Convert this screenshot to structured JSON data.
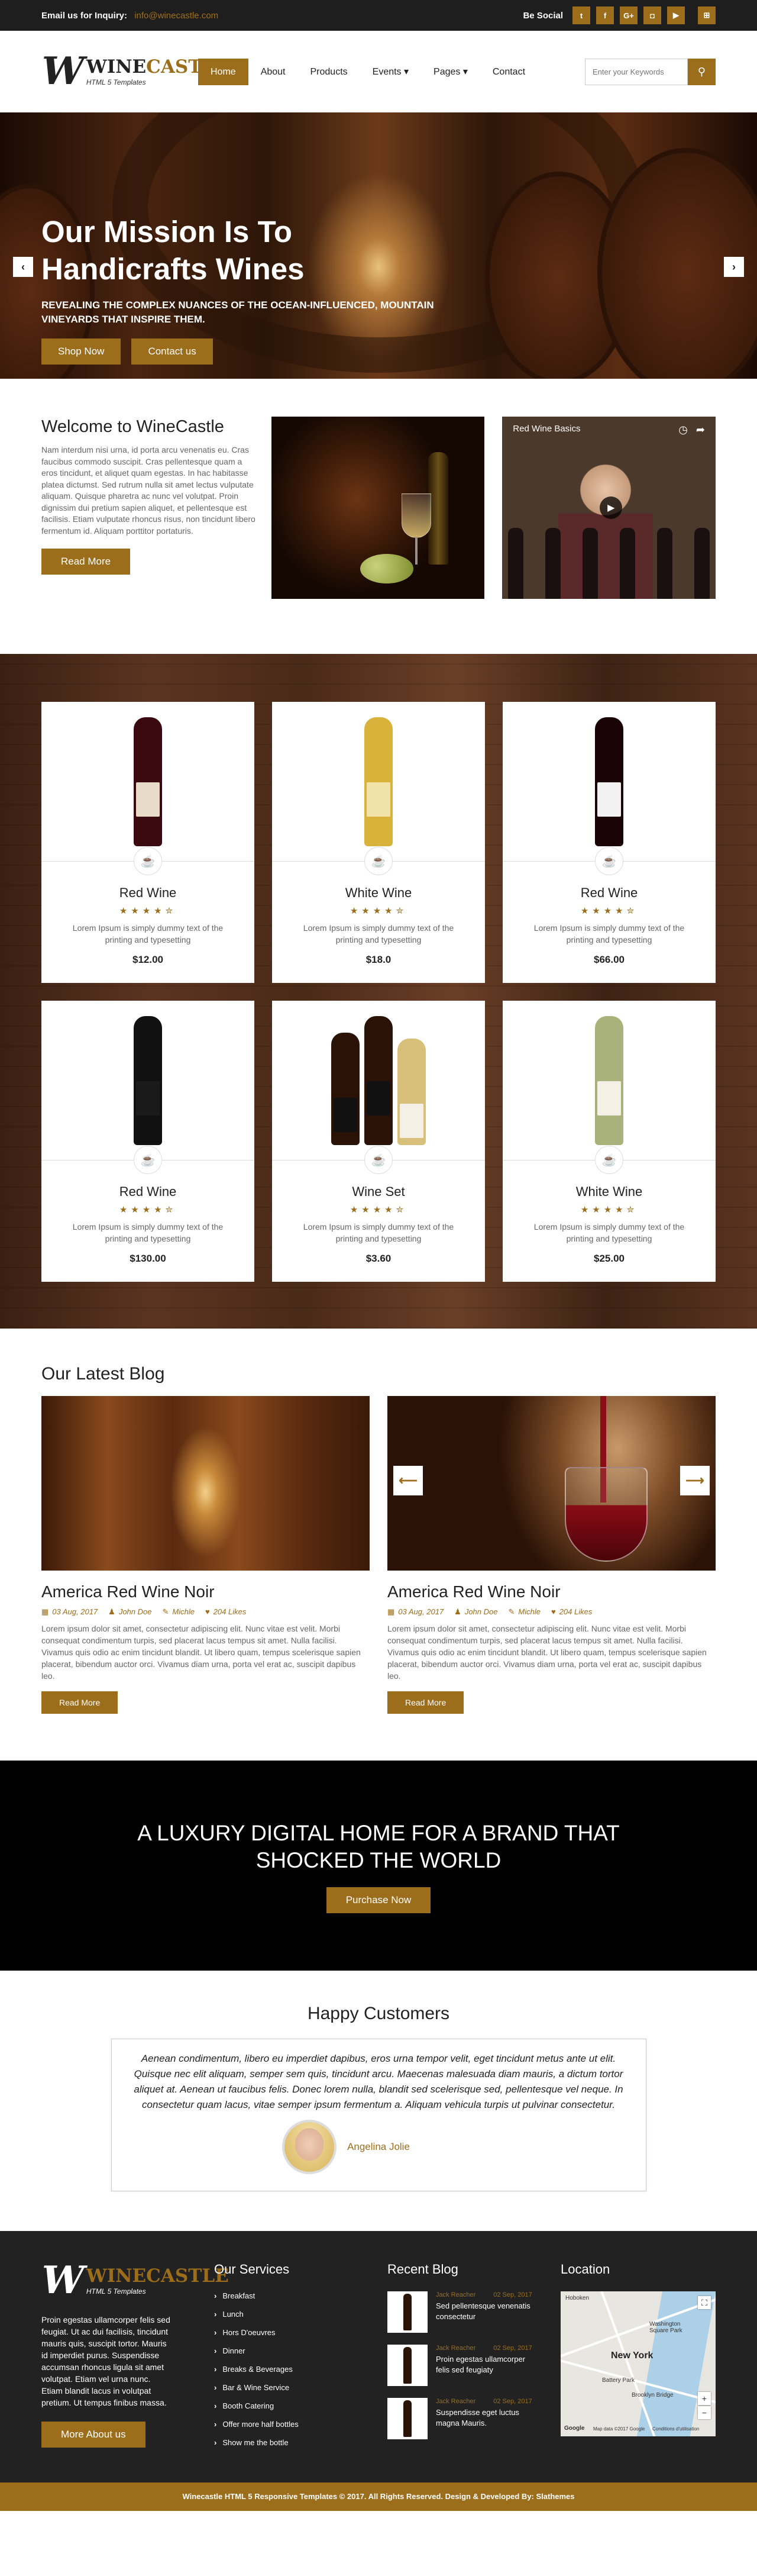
{
  "topbar": {
    "email_label": "Email us for Inquiry:",
    "email": "info@winecastle.com",
    "social_label": "Be Social",
    "social": [
      {
        "icon": "twitter-icon",
        "glyph": "t"
      },
      {
        "icon": "facebook-icon",
        "glyph": "f"
      },
      {
        "icon": "google-plus-icon",
        "glyph": "G+"
      },
      {
        "icon": "instagram-icon",
        "glyph": "◘"
      },
      {
        "icon": "youtube-icon",
        "glyph": "▶"
      },
      {
        "icon": "cart-icon",
        "glyph": "⊞"
      }
    ]
  },
  "logo": {
    "prefix": "WINE",
    "suffix": "CASTLE",
    "sub": "HTML 5 Templates"
  },
  "nav": [
    "Home",
    "About",
    "Products",
    "Events ▾",
    "Pages ▾",
    "Contact"
  ],
  "search": {
    "placeholder": "Enter your Keywords"
  },
  "hero": {
    "title": "Our Mission Is To Handicrafts Wines",
    "subtitle": "REVEALING THE COMPLEX NUANCES OF THE OCEAN-INFLUENCED, MOUNTAIN VINEYARDS THAT INSPIRE THEM.",
    "btn1": "Shop Now",
    "btn2": "Contact us",
    "prev": "‹",
    "next": "›"
  },
  "welcome": {
    "title": "Welcome to WineCastle",
    "text": "Nam interdum nisi urna, id porta arcu venenatis eu. Cras faucibus commodo suscipit. Cras pellentesque quam a eros tincidunt, et aliquet quam egestas. In hac habitasse platea dictumst. Sed rutrum nulla sit amet lectus vulputate aliquam. Quisque pharetra ac nunc vel volutpat. Proin dignissim dui pretium sapien aliquet, et pellentesque est facilisis. Etiam vulputate rhoncus risus, non tincidunt libero fermentum id. Aliquam porttitor portaturis.",
    "btn": "Read More",
    "video_title": "Red Wine Basics"
  },
  "products": [
    {
      "name": "Red Wine",
      "desc": "Lorem Ipsum is simply dummy text of the printing and typesetting",
      "price": "$12.00",
      "stars": "★★★★✮",
      "glass": "#3b0a10",
      "label": "#e8dcc8"
    },
    {
      "name": "White Wine",
      "desc": "Lorem Ipsum is simply dummy text of the printing and typesetting",
      "price": "$18.0",
      "stars": "★★★★✮",
      "glass": "#d8b23a",
      "label": "#f0e2a8"
    },
    {
      "name": "Red Wine",
      "desc": "Lorem Ipsum is simply dummy text of the printing and typesetting",
      "price": "$66.00",
      "stars": "★★★★✮",
      "glass": "#1a0406",
      "label": "#f2f2f2"
    },
    {
      "name": "Red Wine",
      "desc": "Lorem Ipsum is simply dummy text of the printing and typesetting",
      "price": "$130.00",
      "stars": "★★★★✮",
      "glass": "#111111",
      "label": "#1a1a1a"
    },
    {
      "name": "Wine Set",
      "desc": "Lorem Ipsum is simply dummy text of the printing and typesetting",
      "price": "$3.60",
      "stars": "★★★★✮",
      "glass": "#2a1206",
      "label": "#111111"
    },
    {
      "name": "White Wine",
      "desc": "Lorem Ipsum is simply dummy text of the printing and typesetting",
      "price": "$25.00",
      "stars": "★★★★✮",
      "glass": "#a8b27a",
      "label": "#f4f0e6"
    }
  ],
  "blog": {
    "title": "Our Latest Blog",
    "posts": [
      {
        "title": "America Red Wine Noir",
        "date": "03 Aug, 2017",
        "author": "John Doe",
        "cat": "Michle",
        "likes": "204 Likes",
        "excerpt": "Lorem ipsum dolor sit amet, consectetur adipiscing elit. Nunc vitae est velit. Morbi consequat condimentum turpis, sed placerat lacus tempus sit amet. Nulla facilisi. Vivamus quis odio ac enim tincidunt blandit. Ut libero quam, tempus scelerisque sapien placerat, bibendum auctor orci. Vivamus diam urna, porta vel erat ac, suscipit dapibus leo.",
        "btn": "Read More"
      },
      {
        "title": "America Red Wine Noir",
        "date": "03 Aug, 2017",
        "author": "John Doe",
        "cat": "Michle",
        "likes": "204 Likes",
        "excerpt": "Lorem ipsum dolor sit amet, consectetur adipiscing elit. Nunc vitae est velit. Morbi consequat condimentum turpis, sed placerat lacus tempus sit amet. Nulla facilisi. Vivamus quis odio ac enim tincidunt blandit. Ut libero quam, tempus scelerisque sapien placerat, bibendum auctor orci. Vivamus diam urna, porta vel erat ac, suscipit dapibus leo.",
        "btn": "Read More"
      }
    ],
    "prev": "⟵",
    "next": "⟶"
  },
  "banner": {
    "title": "A LUXURY DIGITAL HOME FOR A BRAND THAT SHOCKED THE WORLD",
    "btn": "Purchase Now"
  },
  "testimonial": {
    "title": "Happy Customers",
    "quote": "Aenean condimentum, libero eu imperdiet dapibus, eros urna tempor velit, eget tincidunt metus ante ut elit. Quisque nec elit aliquam, semper sem quis, tincidunt arcu. Maecenas malesuada diam mauris, a dictum tortor aliquet at. Aenean ut faucibus felis. Donec lorem nulla, blandit sed scelerisque sed, pellentesque vel neque. In consectetur quam lacus, vitae semper ipsum fermentum a. Aliquam vehicula turpis ut pulvinar consectetur.",
    "name": "Angelina Jolie"
  },
  "footer": {
    "about": "Proin egestas ullamcorper felis sed feugiat. Ut ac dui facilisis, tincidunt mauris quis, suscipit tortor. Mauris id imperdiet purus. Suspendisse accumsan rhoncus ligula sit amet volutpat. Etiam vel urna nunc. Etiam blandit lacus in volutpat pretium. Ut tempus finibus massa.",
    "about_btn": "More About us",
    "services_title": "Our Services",
    "services": [
      "Breakfast",
      "Lunch",
      "Hors D'oeuvres",
      "Dinner",
      "Breaks & Beverages",
      "Bar & Wine Service",
      "Booth Catering",
      "Offer more half bottles",
      "Show me the bottle"
    ],
    "recent_title": "Recent Blog",
    "recent": [
      {
        "author": "Jack Reacher",
        "date": "02 Sep, 2017",
        "text": "Sed pellentesque venenatis consectetur"
      },
      {
        "author": "Jack Reacher",
        "date": "02 Sep, 2017",
        "text": "Proin egestas ullamcorper felis sed feugiaty"
      },
      {
        "author": "Jack Reacher",
        "date": "02 Sep, 2017",
        "text": "Suspendisse eget luctus magna Mauris."
      }
    ],
    "location_title": "Location",
    "map": {
      "city": "New York",
      "l1": "Hoboken",
      "l2": "Washington Square Park",
      "l3": "Battery Park",
      "l4": "Brooklyn Bridge",
      "l5": "Google",
      "l6": "Map data ©2017 Google",
      "l7": "Conditions d'utilisation"
    },
    "copyright": "Winecastle HTML 5 Responsive Templates © 2017. All Rights Reserved. Design & Developed By: Slathemes"
  }
}
